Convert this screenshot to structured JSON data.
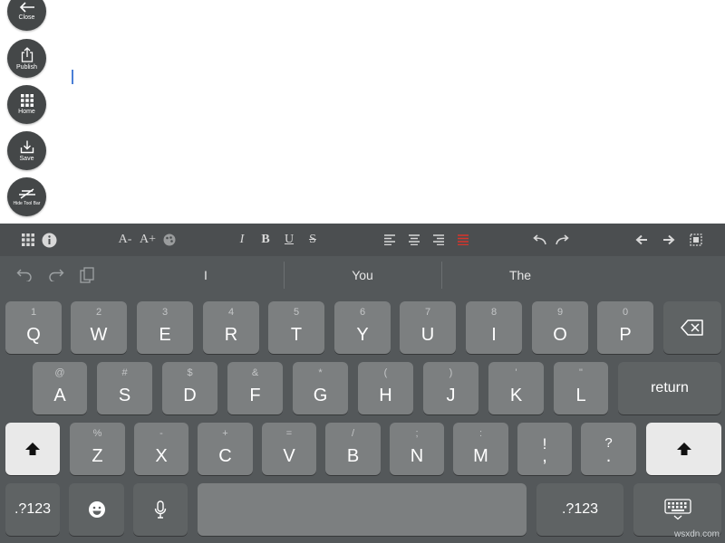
{
  "side_buttons": {
    "close": "Close",
    "publish": "Publish",
    "home": "Home",
    "save": "Save",
    "hide_toolbar": "Hide Tool Bar"
  },
  "toolbar": {
    "italic": "I",
    "bold": "B",
    "underline": "U",
    "strikethrough": "S",
    "font_smaller": "A-",
    "font_larger": "A+"
  },
  "suggestions": [
    "I",
    "You",
    "The"
  ],
  "keyboard": {
    "row1": [
      {
        "hint": "1",
        "label": "Q"
      },
      {
        "hint": "2",
        "label": "W"
      },
      {
        "hint": "3",
        "label": "E"
      },
      {
        "hint": "4",
        "label": "R"
      },
      {
        "hint": "5",
        "label": "T"
      },
      {
        "hint": "6",
        "label": "Y"
      },
      {
        "hint": "7",
        "label": "U"
      },
      {
        "hint": "8",
        "label": "I"
      },
      {
        "hint": "9",
        "label": "O"
      },
      {
        "hint": "0",
        "label": "P"
      }
    ],
    "row2": [
      {
        "hint": "@",
        "label": "A"
      },
      {
        "hint": "#",
        "label": "S"
      },
      {
        "hint": "$",
        "label": "D"
      },
      {
        "hint": "&",
        "label": "F"
      },
      {
        "hint": "*",
        "label": "G"
      },
      {
        "hint": "(",
        "label": "H"
      },
      {
        "hint": ")",
        "label": "J"
      },
      {
        "hint": "'",
        "label": "K"
      },
      {
        "hint": "\"",
        "label": "L"
      }
    ],
    "row3": [
      {
        "hint": "%",
        "label": "Z"
      },
      {
        "hint": "-",
        "label": "X"
      },
      {
        "hint": "+",
        "label": "C"
      },
      {
        "hint": "=",
        "label": "V"
      },
      {
        "hint": "/",
        "label": "B"
      },
      {
        "hint": ";",
        "label": "N"
      },
      {
        "hint": ":",
        "label": "M"
      },
      {
        "hint": "!",
        "label": ","
      },
      {
        "hint": "?",
        "label": "."
      }
    ],
    "return_label": "return",
    "numbers_label": ".?123"
  },
  "watermark": "wsxdn.com",
  "colors": {
    "toolbar_bg": "#4b4e50",
    "keyboard_bg": "#54585a",
    "key": "#7c7f80",
    "caret": "#4a7fd6",
    "align_active": "#d9342b"
  }
}
